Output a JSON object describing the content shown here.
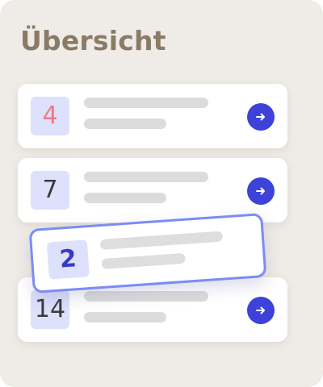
{
  "header": {
    "title": "Übersicht"
  },
  "list": {
    "items": [
      {
        "number": "4",
        "number_color": "#f07a86"
      },
      {
        "number": "7",
        "number_color": "#3a3a3a"
      },
      {
        "number": "14",
        "number_color": "#3a3a3a"
      }
    ],
    "dragging_item": {
      "number": "2",
      "number_color": "#343cc6"
    }
  },
  "colors": {
    "background": "#efece7",
    "title": "#8a7b66",
    "accent": "#3d43d8",
    "badge_bg": "#dde1fb",
    "drag_border": "#7b8cf4",
    "placeholder_line": "#dcdcdc"
  },
  "icons": {
    "go": "arrow-right-icon"
  }
}
